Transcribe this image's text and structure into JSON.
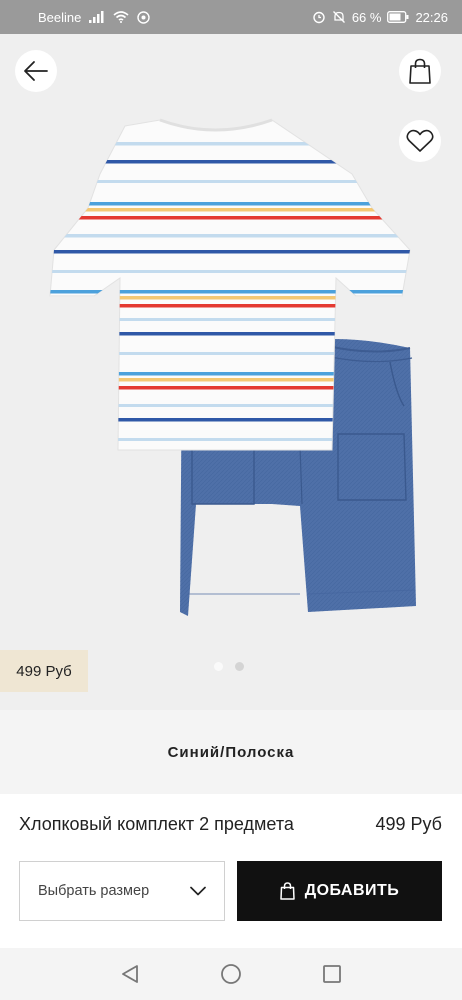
{
  "status_bar": {
    "carrier": "Beeline",
    "battery_percent": "66 %",
    "time": "22:26"
  },
  "product": {
    "image_alt": "product-photo-tshirt-shorts",
    "price_badge": "499 Руб",
    "color_name": "Синий/Полоска",
    "title": "Хлопковый комплект 2 предмета",
    "price": "499 Руб",
    "gallery_pages": 2,
    "gallery_current": 1
  },
  "actions": {
    "size_placeholder": "Выбрать размер",
    "add_button": "ДОБАВИТЬ"
  },
  "icons": {
    "back": "arrow-left-icon",
    "bag": "shopping-bag-icon",
    "favorite": "heart-icon",
    "chevron": "chevron-down-icon",
    "nav_back": "triangle-back-icon",
    "nav_home": "circle-home-icon",
    "nav_recent": "square-recent-icon"
  }
}
